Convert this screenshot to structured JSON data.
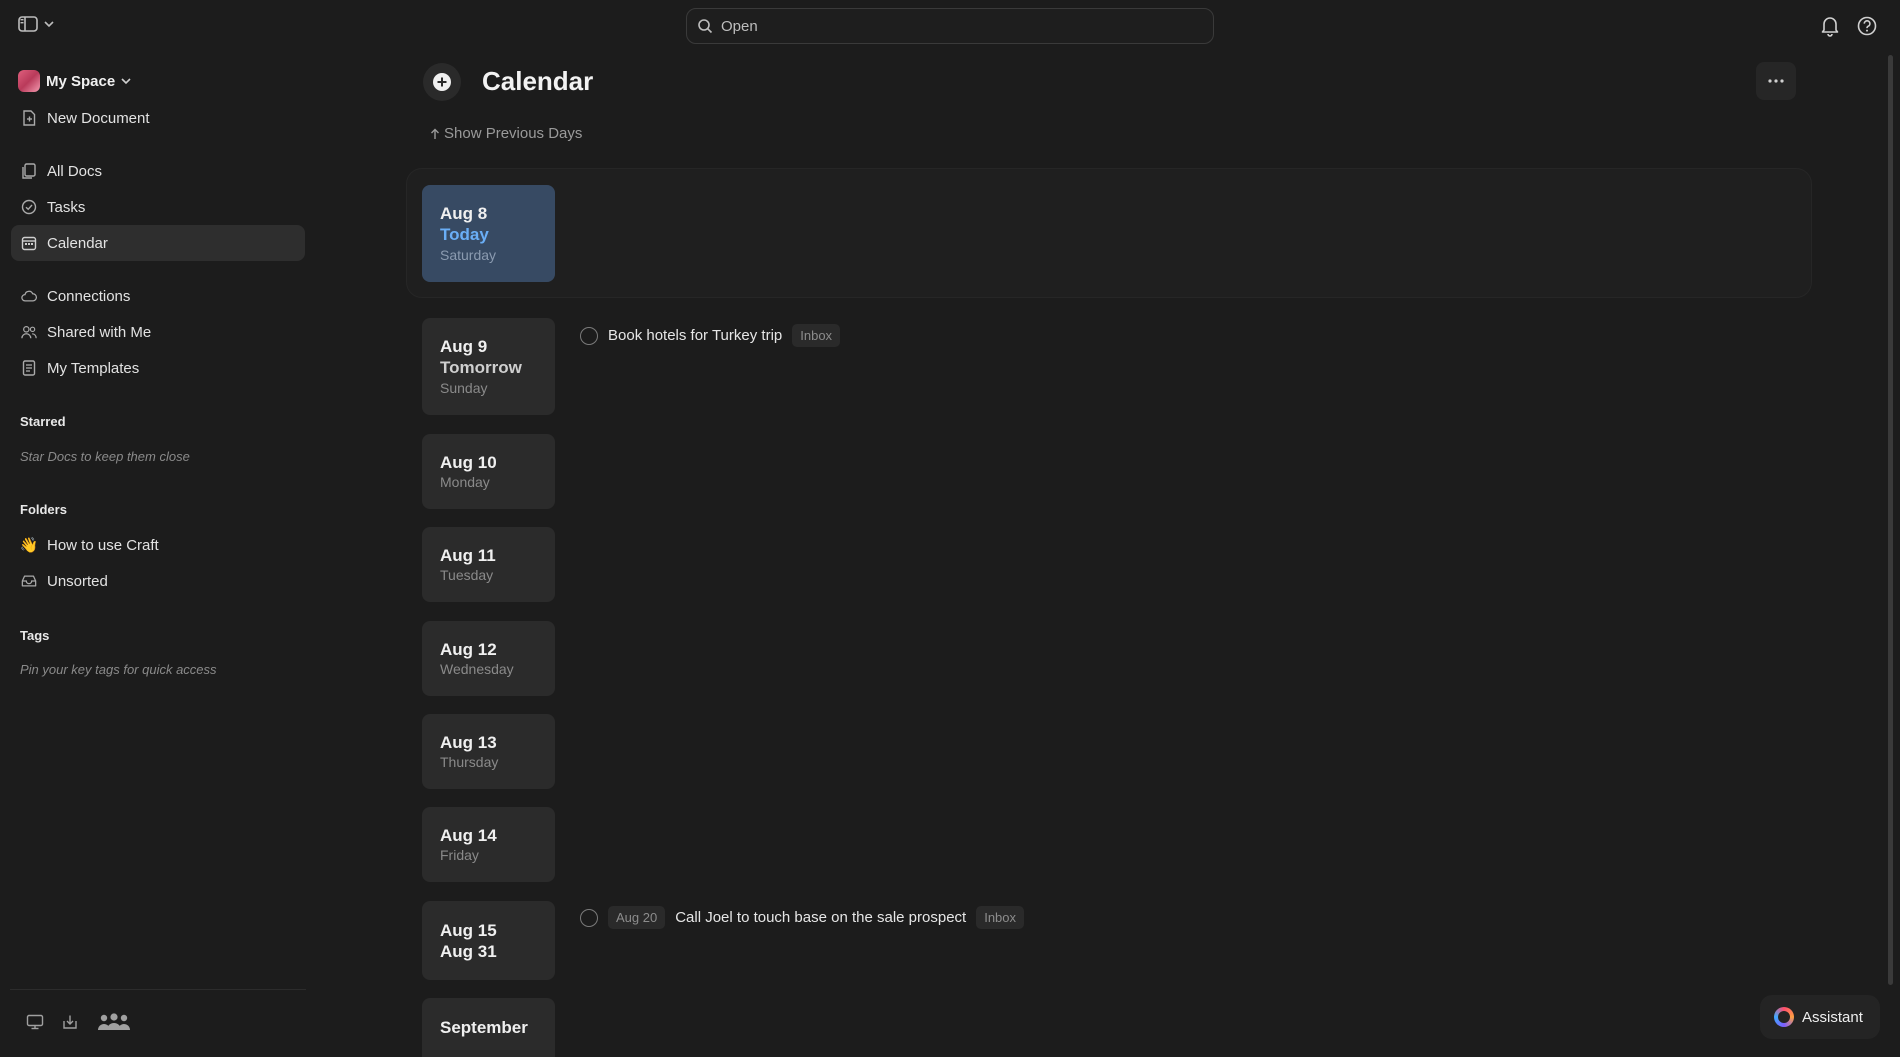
{
  "search": {
    "placeholder": "Open"
  },
  "sidebar": {
    "space_name": "My Space",
    "new_document": "New Document",
    "items": [
      {
        "label": "All Docs"
      },
      {
        "label": "Tasks"
      },
      {
        "label": "Calendar"
      },
      {
        "label": "Connections"
      },
      {
        "label": "Shared with Me"
      },
      {
        "label": "My Templates"
      }
    ],
    "starred": {
      "title": "Starred",
      "hint": "Star Docs to keep them close"
    },
    "folders": {
      "title": "Folders",
      "items": [
        {
          "label": "How to use Craft",
          "emoji": "👋"
        },
        {
          "label": "Unsorted"
        }
      ]
    },
    "tags": {
      "title": "Tags",
      "hint": "Pin your key tags for quick access"
    }
  },
  "main": {
    "title": "Calendar",
    "show_previous": "Show Previous Days",
    "days": [
      {
        "date": "Aug 8",
        "relative": "Today",
        "weekday": "Saturday"
      },
      {
        "date": "Aug 9",
        "relative": "Tomorrow",
        "weekday": "Sunday"
      },
      {
        "date": "Aug 10",
        "weekday": "Monday"
      },
      {
        "date": "Aug 11",
        "weekday": "Tuesday"
      },
      {
        "date": "Aug 12",
        "weekday": "Wednesday"
      },
      {
        "date": "Aug 13",
        "weekday": "Thursday"
      },
      {
        "date": "Aug 14",
        "weekday": "Friday"
      },
      {
        "date": "Aug 15",
        "date_end": "Aug 31"
      },
      {
        "date": "September"
      }
    ],
    "tasks": [
      {
        "text": "Book hotels for Turkey trip",
        "badge": "Inbox"
      },
      {
        "due": "Aug 20",
        "text": "Call Joel to touch base on the sale prospect",
        "badge": "Inbox"
      }
    ]
  },
  "assistant": {
    "label": "Assistant"
  },
  "colors": {
    "background": "#1c1c1c",
    "today_card": "#374a63",
    "today_accent": "#6aaef6"
  }
}
